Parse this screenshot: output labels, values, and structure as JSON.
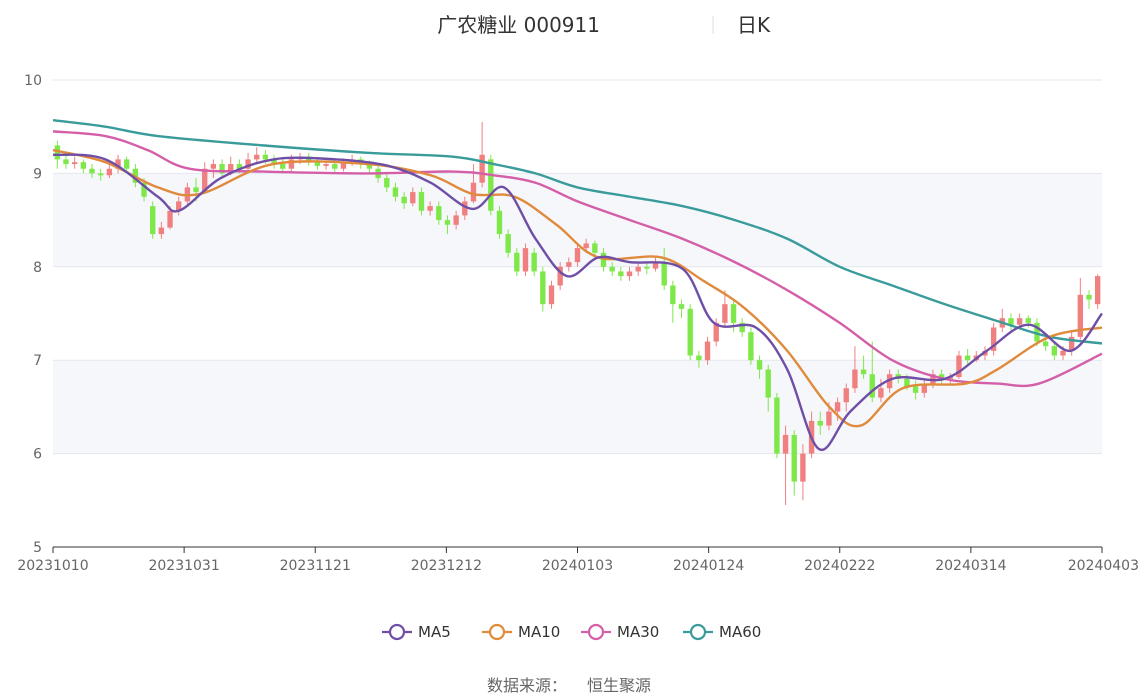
{
  "chart_data": {
    "type": "candlestick",
    "title": "广农糖业 000911",
    "period_label": "日K",
    "source_label": "数据来源：",
    "source_name": "恒生聚源",
    "ylim": [
      5,
      10
    ],
    "yticks": [
      5,
      6,
      7,
      8,
      9,
      10
    ],
    "xticks": [
      "20231010",
      "20231031",
      "20231121",
      "20231212",
      "20240103",
      "20240124",
      "20240222",
      "20240314",
      "20240403"
    ],
    "colors": {
      "up": "#f08080",
      "down": "#7ee84a",
      "band": "#f5f7fb",
      "grid": "#e3e7ee",
      "axis": "#333333"
    },
    "legend": [
      {
        "name": "MA5",
        "color": "#6f4fa6"
      },
      {
        "name": "MA10",
        "color": "#e08a3c"
      },
      {
        "name": "MA30",
        "color": "#d45fa8"
      },
      {
        "name": "MA60",
        "color": "#3a9b9b"
      }
    ],
    "candles": [
      [
        9.3,
        9.15,
        9.35,
        9.05
      ],
      [
        9.15,
        9.1,
        9.2,
        9.05
      ],
      [
        9.1,
        9.12,
        9.18,
        9.05
      ],
      [
        9.12,
        9.05,
        9.15,
        9.0
      ],
      [
        9.05,
        9.0,
        9.1,
        8.95
      ],
      [
        9.0,
        8.98,
        9.05,
        8.92
      ],
      [
        8.98,
        9.05,
        9.1,
        8.95
      ],
      [
        9.05,
        9.15,
        9.2,
        9.0
      ],
      [
        9.15,
        9.05,
        9.18,
        9.0
      ],
      [
        9.05,
        8.9,
        9.1,
        8.85
      ],
      [
        8.9,
        8.75,
        8.95,
        8.7
      ],
      [
        8.65,
        8.35,
        8.7,
        8.3
      ],
      [
        8.35,
        8.42,
        8.48,
        8.3
      ],
      [
        8.42,
        8.6,
        8.65,
        8.4
      ],
      [
        8.6,
        8.7,
        8.75,
        8.55
      ],
      [
        8.7,
        8.85,
        8.9,
        8.65
      ],
      [
        8.85,
        8.8,
        8.95,
        8.7
      ],
      [
        8.8,
        9.05,
        9.12,
        8.78
      ],
      [
        9.05,
        9.1,
        9.15,
        8.95
      ],
      [
        9.1,
        9.0,
        9.15,
        8.95
      ],
      [
        9.0,
        9.1,
        9.18,
        8.98
      ],
      [
        9.1,
        9.05,
        9.15,
        9.0
      ],
      [
        9.05,
        9.15,
        9.22,
        9.02
      ],
      [
        9.15,
        9.2,
        9.28,
        9.1
      ],
      [
        9.2,
        9.15,
        9.25,
        9.1
      ],
      [
        9.15,
        9.1,
        9.2,
        9.05
      ],
      [
        9.1,
        9.05,
        9.15,
        9.0
      ],
      [
        9.05,
        9.15,
        9.2,
        9.0
      ],
      [
        9.15,
        9.18,
        9.22,
        9.1
      ],
      [
        9.18,
        9.12,
        9.22,
        9.08
      ],
      [
        9.12,
        9.08,
        9.16,
        9.04
      ],
      [
        9.08,
        9.1,
        9.14,
        9.04
      ],
      [
        9.1,
        9.05,
        9.14,
        9.0
      ],
      [
        9.05,
        9.12,
        9.16,
        9.02
      ],
      [
        9.12,
        9.15,
        9.2,
        9.08
      ],
      [
        9.15,
        9.1,
        9.18,
        9.05
      ],
      [
        9.1,
        9.05,
        9.14,
        9.0
      ],
      [
        9.05,
        8.95,
        9.08,
        8.9
      ],
      [
        8.95,
        8.85,
        9.0,
        8.8
      ],
      [
        8.85,
        8.75,
        8.9,
        8.7
      ],
      [
        8.75,
        8.68,
        8.8,
        8.62
      ],
      [
        8.68,
        8.8,
        8.85,
        8.65
      ],
      [
        8.8,
        8.6,
        8.85,
        8.55
      ],
      [
        8.6,
        8.65,
        8.7,
        8.55
      ],
      [
        8.65,
        8.5,
        8.7,
        8.45
      ],
      [
        8.5,
        8.45,
        8.55,
        8.35
      ],
      [
        8.45,
        8.55,
        8.6,
        8.4
      ],
      [
        8.55,
        8.7,
        8.75,
        8.5
      ],
      [
        8.7,
        8.9,
        9.1,
        8.68
      ],
      [
        8.9,
        9.2,
        9.55,
        8.85
      ],
      [
        9.15,
        8.6,
        9.2,
        8.55
      ],
      [
        8.6,
        8.35,
        8.65,
        8.3
      ],
      [
        8.35,
        8.15,
        8.4,
        8.1
      ],
      [
        8.15,
        7.95,
        8.2,
        7.9
      ],
      [
        7.95,
        8.2,
        8.25,
        7.9
      ],
      [
        8.15,
        7.95,
        8.2,
        7.9
      ],
      [
        7.95,
        7.6,
        8.0,
        7.52
      ],
      [
        7.6,
        7.8,
        7.85,
        7.55
      ],
      [
        7.8,
        8.0,
        8.05,
        7.75
      ],
      [
        8.0,
        8.05,
        8.1,
        7.95
      ],
      [
        8.05,
        8.2,
        8.25,
        8.0
      ],
      [
        8.2,
        8.25,
        8.3,
        8.15
      ],
      [
        8.25,
        8.15,
        8.28,
        8.1
      ],
      [
        8.15,
        8.0,
        8.2,
        7.95
      ],
      [
        8.0,
        7.95,
        8.05,
        7.9
      ],
      [
        7.95,
        7.9,
        8.0,
        7.85
      ],
      [
        7.9,
        7.95,
        8.0,
        7.85
      ],
      [
        7.95,
        8.0,
        8.05,
        7.9
      ],
      [
        8.0,
        7.98,
        8.05,
        7.92
      ],
      [
        7.98,
        8.05,
        8.1,
        7.95
      ],
      [
        8.05,
        7.8,
        8.2,
        7.75
      ],
      [
        7.8,
        7.6,
        7.85,
        7.4
      ],
      [
        7.6,
        7.55,
        7.65,
        7.45
      ],
      [
        7.55,
        7.05,
        7.6,
        7.0
      ],
      [
        7.05,
        7.0,
        7.1,
        6.92
      ],
      [
        7.0,
        7.2,
        7.25,
        6.95
      ],
      [
        7.2,
        7.4,
        7.45,
        7.15
      ],
      [
        7.4,
        7.6,
        7.75,
        7.35
      ],
      [
        7.6,
        7.4,
        7.65,
        7.3
      ],
      [
        7.4,
        7.3,
        7.45,
        7.25
      ],
      [
        7.3,
        7.0,
        7.35,
        6.95
      ],
      [
        7.0,
        6.9,
        7.05,
        6.8
      ],
      [
        6.9,
        6.6,
        6.95,
        6.45
      ],
      [
        6.6,
        6.0,
        6.65,
        5.95
      ],
      [
        6.0,
        6.2,
        6.3,
        5.45
      ],
      [
        6.2,
        5.7,
        6.25,
        5.55
      ],
      [
        5.7,
        6.0,
        6.1,
        5.5
      ],
      [
        6.0,
        6.35,
        6.45,
        5.95
      ],
      [
        6.35,
        6.3,
        6.45,
        6.2
      ],
      [
        6.3,
        6.45,
        6.55,
        6.25
      ],
      [
        6.45,
        6.55,
        6.6,
        6.35
      ],
      [
        6.55,
        6.7,
        6.75,
        6.45
      ],
      [
        6.7,
        6.9,
        7.15,
        6.65
      ],
      [
        6.9,
        6.85,
        7.05,
        6.8
      ],
      [
        6.85,
        6.6,
        7.2,
        6.55
      ],
      [
        6.6,
        6.7,
        6.8,
        6.55
      ],
      [
        6.7,
        6.85,
        6.9,
        6.65
      ],
      [
        6.85,
        6.8,
        6.9,
        6.75
      ],
      [
        6.8,
        6.72,
        6.85,
        6.68
      ],
      [
        6.72,
        6.65,
        6.78,
        6.58
      ],
      [
        6.65,
        6.75,
        6.8,
        6.6
      ],
      [
        6.75,
        6.85,
        6.9,
        6.7
      ],
      [
        6.85,
        6.8,
        6.9,
        6.75
      ],
      [
        6.8,
        6.82,
        6.86,
        6.75
      ],
      [
        6.82,
        7.05,
        7.1,
        6.8
      ],
      [
        7.05,
        7.0,
        7.12,
        6.95
      ],
      [
        7.0,
        7.05,
        7.1,
        6.98
      ],
      [
        7.05,
        7.1,
        7.15,
        7.0
      ],
      [
        7.1,
        7.35,
        7.4,
        7.05
      ],
      [
        7.35,
        7.45,
        7.55,
        7.3
      ],
      [
        7.45,
        7.38,
        7.5,
        7.32
      ],
      [
        7.38,
        7.45,
        7.5,
        7.35
      ],
      [
        7.45,
        7.4,
        7.48,
        7.35
      ],
      [
        7.4,
        7.2,
        7.45,
        7.15
      ],
      [
        7.2,
        7.15,
        7.25,
        7.1
      ],
      [
        7.15,
        7.05,
        7.2,
        7.0
      ],
      [
        7.05,
        7.1,
        7.15,
        7.0
      ],
      [
        7.1,
        7.25,
        7.3,
        7.05
      ],
      [
        7.25,
        7.7,
        7.88,
        7.22
      ],
      [
        7.7,
        7.65,
        7.75,
        7.55
      ],
      [
        7.6,
        7.9,
        7.92,
        7.55
      ]
    ],
    "ma": {
      "MA5": [
        [
          0,
          9.2
        ],
        [
          0.05,
          9.15
        ],
        [
          0.1,
          8.75
        ],
        [
          0.12,
          8.6
        ],
        [
          0.16,
          8.95
        ],
        [
          0.21,
          9.15
        ],
        [
          0.27,
          9.15
        ],
        [
          0.32,
          9.08
        ],
        [
          0.36,
          8.9
        ],
        [
          0.4,
          8.62
        ],
        [
          0.43,
          8.85
        ],
        [
          0.46,
          8.3
        ],
        [
          0.49,
          7.9
        ],
        [
          0.52,
          8.1
        ],
        [
          0.55,
          8.05
        ],
        [
          0.6,
          7.98
        ],
        [
          0.63,
          7.4
        ],
        [
          0.67,
          7.35
        ],
        [
          0.7,
          6.9
        ],
        [
          0.73,
          6.05
        ],
        [
          0.76,
          6.45
        ],
        [
          0.8,
          6.8
        ],
        [
          0.85,
          6.8
        ],
        [
          0.89,
          7.1
        ],
        [
          0.93,
          7.38
        ],
        [
          0.97,
          7.1
        ],
        [
          1.0,
          7.5
        ]
      ],
      "MA10": [
        [
          0,
          9.25
        ],
        [
          0.05,
          9.12
        ],
        [
          0.1,
          8.85
        ],
        [
          0.14,
          8.78
        ],
        [
          0.21,
          9.1
        ],
        [
          0.3,
          9.1
        ],
        [
          0.36,
          8.98
        ],
        [
          0.4,
          8.78
        ],
        [
          0.44,
          8.75
        ],
        [
          0.48,
          8.45
        ],
        [
          0.52,
          8.1
        ],
        [
          0.58,
          8.1
        ],
        [
          0.62,
          7.85
        ],
        [
          0.66,
          7.55
        ],
        [
          0.7,
          7.1
        ],
        [
          0.74,
          6.5
        ],
        [
          0.77,
          6.3
        ],
        [
          0.81,
          6.7
        ],
        [
          0.87,
          6.75
        ],
        [
          0.9,
          6.9
        ],
        [
          0.95,
          7.25
        ],
        [
          1.0,
          7.35
        ]
      ],
      "MA30": [
        [
          0,
          9.45
        ],
        [
          0.05,
          9.4
        ],
        [
          0.09,
          9.25
        ],
        [
          0.13,
          9.05
        ],
        [
          0.2,
          9.02
        ],
        [
          0.3,
          9.0
        ],
        [
          0.38,
          9.02
        ],
        [
          0.42,
          8.98
        ],
        [
          0.46,
          8.9
        ],
        [
          0.5,
          8.7
        ],
        [
          0.55,
          8.5
        ],
        [
          0.6,
          8.3
        ],
        [
          0.65,
          8.05
        ],
        [
          0.7,
          7.75
        ],
        [
          0.75,
          7.4
        ],
        [
          0.8,
          7.0
        ],
        [
          0.85,
          6.8
        ],
        [
          0.9,
          6.75
        ],
        [
          0.94,
          6.75
        ],
        [
          1.0,
          7.07
        ]
      ],
      "MA60": [
        [
          0,
          9.57
        ],
        [
          0.05,
          9.5
        ],
        [
          0.1,
          9.4
        ],
        [
          0.2,
          9.3
        ],
        [
          0.3,
          9.22
        ],
        [
          0.38,
          9.18
        ],
        [
          0.42,
          9.1
        ],
        [
          0.46,
          9.0
        ],
        [
          0.5,
          8.85
        ],
        [
          0.55,
          8.75
        ],
        [
          0.6,
          8.65
        ],
        [
          0.65,
          8.5
        ],
        [
          0.7,
          8.3
        ],
        [
          0.75,
          8.0
        ],
        [
          0.8,
          7.8
        ],
        [
          0.85,
          7.6
        ],
        [
          0.9,
          7.42
        ],
        [
          0.95,
          7.25
        ],
        [
          1.0,
          7.18
        ]
      ]
    }
  }
}
